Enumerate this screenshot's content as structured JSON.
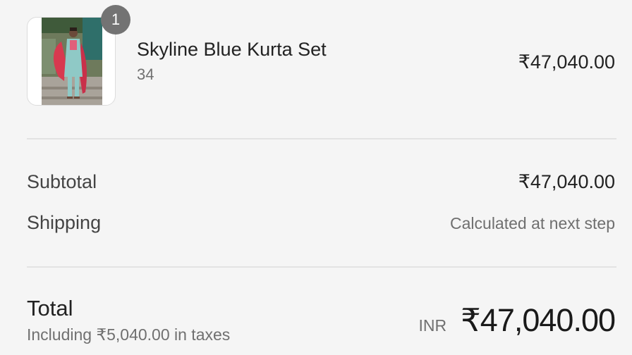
{
  "line_item": {
    "quantity": "1",
    "name": "Skyline Blue Kurta Set",
    "variant": "34",
    "price": "₹47,040.00",
    "image_icon": "product-photo-icon"
  },
  "costs": {
    "subtotal_label": "Subtotal",
    "subtotal_value": "₹47,040.00",
    "shipping_label": "Shipping",
    "shipping_value": "Calculated at next step"
  },
  "total": {
    "label": "Total",
    "tax_note": "Including ₹5,040.00 in taxes",
    "currency_code": "INR",
    "value": "₹47,040.00"
  },
  "colors": {
    "background": "#f5f5f5",
    "badge": "#737373",
    "divider": "#e3e3e3",
    "muted_text": "#707070"
  }
}
